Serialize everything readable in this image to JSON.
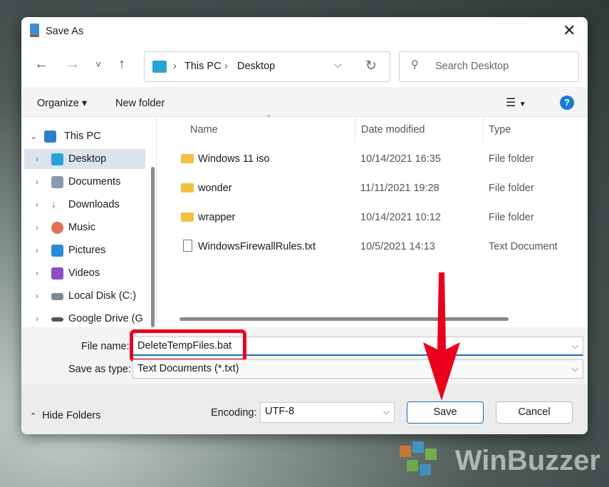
{
  "title": "Save As",
  "nav": {
    "back": "←",
    "forward": "→",
    "recent": "˅",
    "up": "↑"
  },
  "address": {
    "crumbs": [
      "This PC",
      "Desktop"
    ]
  },
  "search": {
    "placeholder": "Search Desktop"
  },
  "toolbar": {
    "organize": "Organize ▾",
    "new_folder": "New folder",
    "help": "?"
  },
  "sidebar": {
    "root": "This PC",
    "items": [
      {
        "label": "Desktop",
        "color": "#2aa0d8"
      },
      {
        "label": "Documents",
        "color": "#8a9bb0"
      },
      {
        "label": "Downloads",
        "color": "#2e9e6a"
      },
      {
        "label": "Music",
        "color": "#e0705a"
      },
      {
        "label": "Pictures",
        "color": "#2b8ad8"
      },
      {
        "label": "Videos",
        "color": "#8a4fc7"
      },
      {
        "label": "Local Disk (C:)",
        "color": "#7a8a9a"
      },
      {
        "label": "Google Drive (G",
        "color": "#555555"
      }
    ]
  },
  "columns": [
    "Name",
    "Date modified",
    "Type"
  ],
  "files": [
    {
      "name": "Windows 11 iso",
      "date": "10/14/2021 16:35",
      "type": "File folder",
      "kind": "folder"
    },
    {
      "name": "wonder",
      "date": "11/11/2021 19:28",
      "type": "File folder",
      "kind": "folder"
    },
    {
      "name": "wrapper",
      "date": "10/14/2021 10:12",
      "type": "File folder",
      "kind": "folder"
    },
    {
      "name": "WindowsFirewallRules.txt",
      "date": "10/5/2021 14:13",
      "type": "Text Document",
      "kind": "file"
    }
  ],
  "form": {
    "file_name_label": "File name:",
    "file_name": "DeleteTempFiles.bat",
    "type_label": "Save as type:",
    "type": "Text Documents (*.txt)",
    "encoding_label": "Encoding:",
    "encoding": "UTF-8",
    "hide_folders": "Hide Folders",
    "save": "Save",
    "cancel": "Cancel"
  },
  "watermark": "WinBuzzer"
}
